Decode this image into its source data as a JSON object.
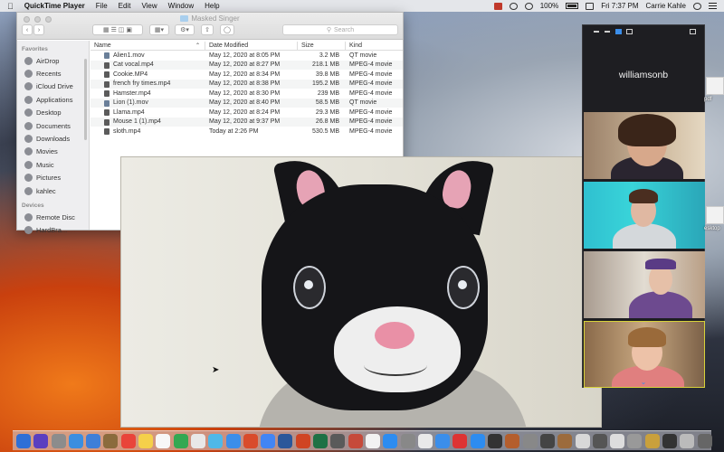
{
  "menubar": {
    "app_name": "QuickTime Player",
    "menus": [
      "File",
      "Edit",
      "View",
      "Window",
      "Help"
    ],
    "battery": "100%",
    "clock": "Fri 7:37 PM",
    "user": "Carrie Kahle"
  },
  "finder": {
    "title": "Masked Singer",
    "search_placeholder": "Search",
    "sidebar": {
      "favorites_label": "Favorites",
      "favorites": [
        "AirDrop",
        "Recents",
        "iCloud Drive",
        "Applications",
        "Desktop",
        "Documents",
        "Downloads",
        "Movies",
        "Music",
        "Pictures",
        "kahlec"
      ],
      "devices_label": "Devices",
      "devices": [
        "Remote Disc",
        "HardBra..."
      ]
    },
    "columns": {
      "name": "Name",
      "date": "Date Modified",
      "size": "Size",
      "kind": "Kind"
    },
    "files": [
      {
        "name": "Alien1.mov",
        "date": "May 12, 2020 at 8:05 PM",
        "size": "3.2 MB",
        "kind": "QT movie"
      },
      {
        "name": "Cat vocal.mp4",
        "date": "May 12, 2020 at 8:27 PM",
        "size": "218.1 MB",
        "kind": "MPEG-4 movie"
      },
      {
        "name": "Cookie.MP4",
        "date": "May 12, 2020 at 8:34 PM",
        "size": "39.8 MB",
        "kind": "MPEG-4 movie"
      },
      {
        "name": "french fry times.mp4",
        "date": "May 12, 2020 at 8:38 PM",
        "size": "195.2 MB",
        "kind": "MPEG-4 movie"
      },
      {
        "name": "Hamster.mp4",
        "date": "May 12, 2020 at 8:30 PM",
        "size": "239 MB",
        "kind": "MPEG-4 movie"
      },
      {
        "name": "Lion (1).mov",
        "date": "May 12, 2020 at 8:40 PM",
        "size": "58.5 MB",
        "kind": "QT movie"
      },
      {
        "name": "Llama.mp4",
        "date": "May 12, 2020 at 8:24 PM",
        "size": "29.3 MB",
        "kind": "MPEG-4 movie"
      },
      {
        "name": "Mouse 1 (1).mp4",
        "date": "May 12, 2020 at 9:37 PM",
        "size": "26.8 MB",
        "kind": "MPEG-4 movie"
      },
      {
        "name": "sloth.mp4",
        "date": "Today at 2:26 PM",
        "size": "530.5 MB",
        "kind": "MPEG-4 movie"
      }
    ]
  },
  "zoom": {
    "active_speaker": "williamsonb",
    "participants": [
      "",
      "",
      "",
      ""
    ]
  },
  "desktop_labels": [
    "pdf",
    "esktop"
  ],
  "dock_colors": [
    "#2f6fd6",
    "#5a3fc0",
    "#8c8c8c",
    "#3a8ee0",
    "#3e7fd8",
    "#8b6b3d",
    "#e9443a",
    "#f5d04a",
    "#f7f7f7",
    "#33a852",
    "#e8e8e8",
    "#4fb8e8",
    "#3b8eea",
    "#d94b2b",
    "#4285f4",
    "#2b579a",
    "#d04423",
    "#1e7145",
    "#5a5a5a",
    "#c64a3a",
    "#f2f2f2",
    "#2d8cf0",
    "#888",
    "#e9e9e9",
    "#3b8eea",
    "#d33",
    "#2d8cf0",
    "#333",
    "#b45e2d",
    "#888",
    "#444",
    "#9c6b3c",
    "#d8d8d8",
    "#555",
    "#ddd",
    "#999",
    "#c9a03c",
    "#333",
    "#bbb",
    "#666"
  ]
}
